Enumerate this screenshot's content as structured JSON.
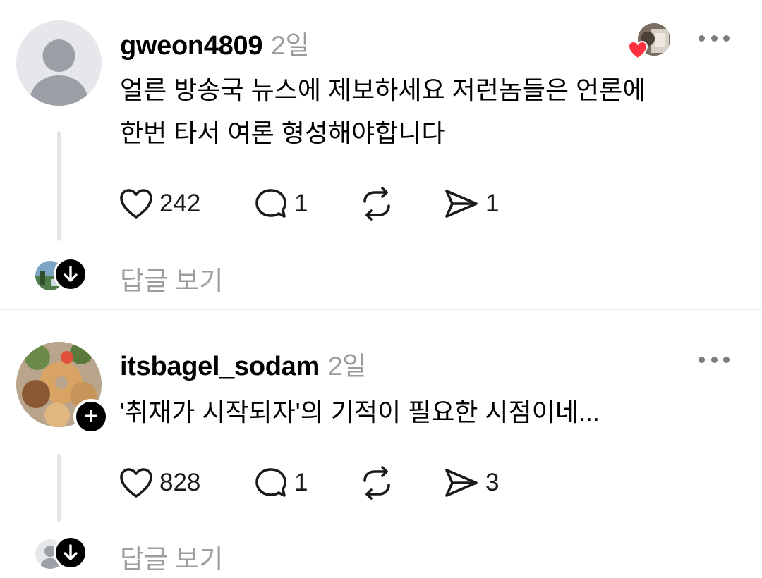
{
  "posts": [
    {
      "username": "gweon4809",
      "time": "2일",
      "text_lines": [
        "얼른 방송국 뉴스에 제보하세요 저런놈들은 언론에",
        "한번 타서 여론 형성해야합니다"
      ],
      "likes": "242",
      "comments": "1",
      "shares": "1",
      "view_replies": "답글 보기",
      "liked_by_author_badge": "heart-icon"
    },
    {
      "username": "itsbagel_sodam",
      "time": "2일",
      "text_lines": [
        "'취재가 시작되자'의 기적이 필요한 시점이네..."
      ],
      "likes": "828",
      "comments": "1",
      "shares": "3",
      "view_replies": "답글 보기",
      "follow_icon": "plus-icon"
    }
  ],
  "colors": {
    "muted_text": "#9a9a9a",
    "divider": "#ececec",
    "heart_badge": "#ff3040",
    "thread_line": "#e3e3e3"
  }
}
